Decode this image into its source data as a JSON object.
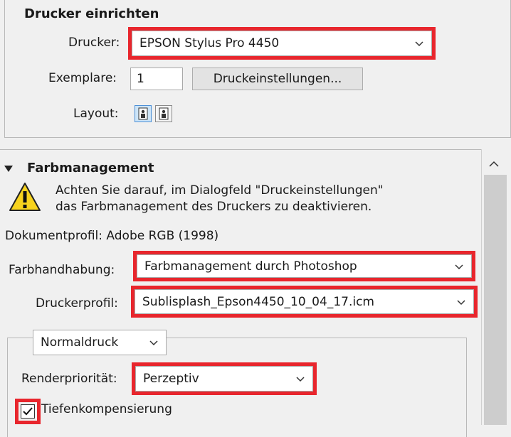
{
  "setup": {
    "title": "Drucker einrichten",
    "printer_label": "Drucker:",
    "printer_value": "EPSON Stylus Pro 4450",
    "copies_label": "Exemplare:",
    "copies_value": "1",
    "print_settings_button": "Druckeinstellungen...",
    "layout_label": "Layout:"
  },
  "color": {
    "title": "Farbmanagement",
    "warning_line1": "Achten Sie darauf, im Dialogfeld \"Druckeinstellungen\"",
    "warning_line2": "das Farbmanagement des Druckers zu deaktivieren.",
    "document_profile": "Dokumentprofil: Adobe RGB (1998)",
    "handling_label": "Farbhandhabung:",
    "handling_value": "Farbmanagement durch Photoshop",
    "printer_profile_label": "Druckerprofil:",
    "printer_profile_value": "Sublisplash_Epson4450_10_04_17.icm",
    "mode_value": "Normaldruck",
    "render_label": "Renderpriorität:",
    "render_value": "Perzeptiv",
    "bpc_label": "Tiefenkompensierung",
    "bpc_checked": true
  },
  "icons": {
    "collapse": "triangle-down-icon",
    "warning": "warning-icon",
    "scroll_up": "chevron-up-icon",
    "dropdown": "chevron-down-icon"
  },
  "highlight_color": "#e8262d"
}
